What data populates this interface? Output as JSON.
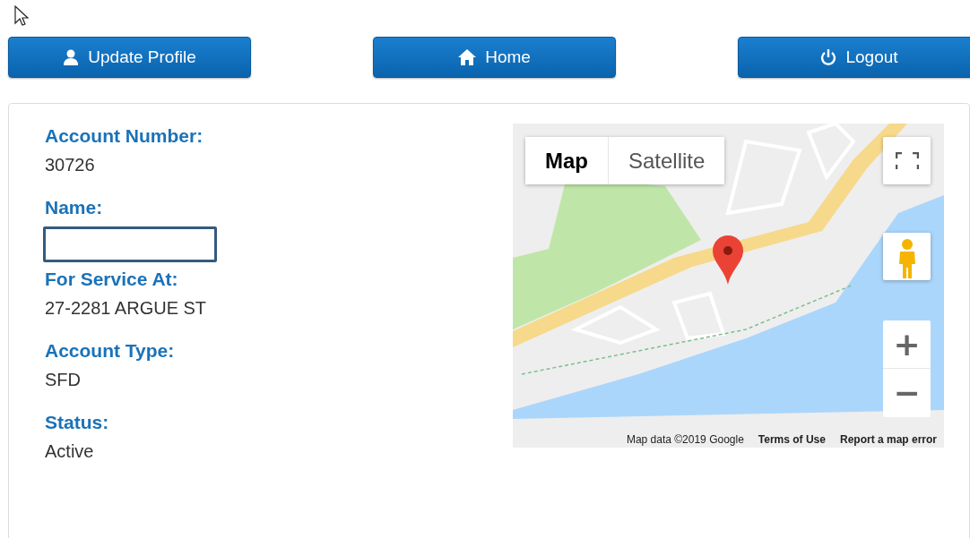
{
  "nav_buttons": [
    {
      "label": "Update Profile"
    },
    {
      "label": "Home"
    },
    {
      "label": "Logout"
    }
  ],
  "account": [
    {
      "kind": "text",
      "label": "Account Number:",
      "value": "30726"
    },
    {
      "kind": "input",
      "label": "Name:"
    },
    {
      "kind": "text",
      "label": "For Service At:",
      "value": "27-2281 ARGUE ST"
    },
    {
      "kind": "text",
      "label": "Account Type:",
      "value": "SFD"
    },
    {
      "kind": "text",
      "label": "Status:",
      "value": "Active"
    }
  ],
  "map": {
    "kind": "picture",
    "map_types": [
      {
        "label": "Map",
        "selected": true
      },
      {
        "label": "Satellite",
        "selected": false
      }
    ],
    "zoom_in": "+",
    "zoom_out": "−",
    "footer": [
      "Map data ©2019 Google",
      "Terms of Use",
      "Report a map error"
    ]
  }
}
